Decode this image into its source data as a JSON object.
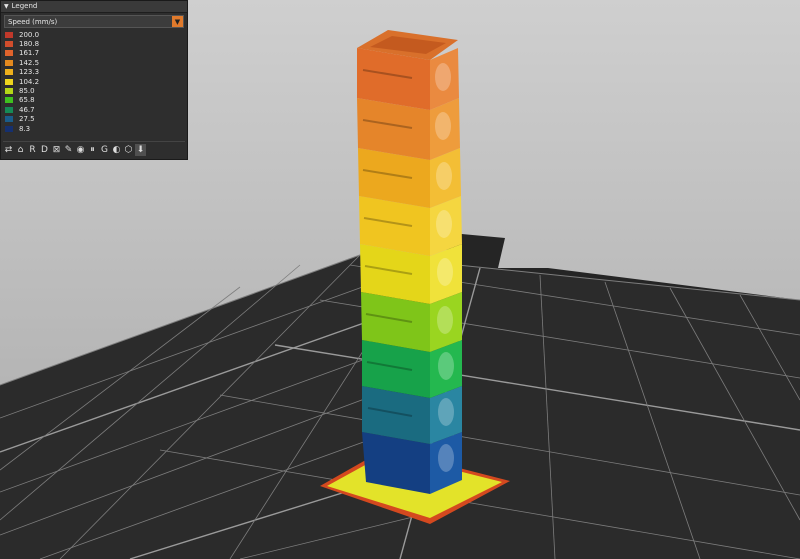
{
  "legend": {
    "title": "Legend",
    "selector": "Speed (mm/s)",
    "items": [
      {
        "label": "200.0",
        "color": "#c0392b"
      },
      {
        "label": "180.8",
        "color": "#d14d2c"
      },
      {
        "label": "161.7",
        "color": "#e0632c"
      },
      {
        "label": "142.5",
        "color": "#e48a1f"
      },
      {
        "label": "123.3",
        "color": "#eeb01c"
      },
      {
        "label": "104.2",
        "color": "#efd51e"
      },
      {
        "label": "85.0",
        "color": "#b5d617"
      },
      {
        "label": "65.8",
        "color": "#3fc11f"
      },
      {
        "label": "46.7",
        "color": "#168a55"
      },
      {
        "label": "27.5",
        "color": "#1a5c8a"
      },
      {
        "label": "8.3",
        "color": "#15306f"
      }
    ]
  },
  "toolbar_icons": [
    "travel-icon",
    "wipe-icon",
    "retraction-icon",
    "deretraction-icon",
    "seam-icon",
    "tool-change-icon",
    "color-change-icon",
    "pause-icon",
    "custom-gcode-icon",
    "center-of-gravity-icon",
    "shells-icon",
    "tool-marker-icon"
  ],
  "colors": {
    "accent": "#e07a2c",
    "bed": "#2c2c2c",
    "grid": "#8a8a8a"
  }
}
